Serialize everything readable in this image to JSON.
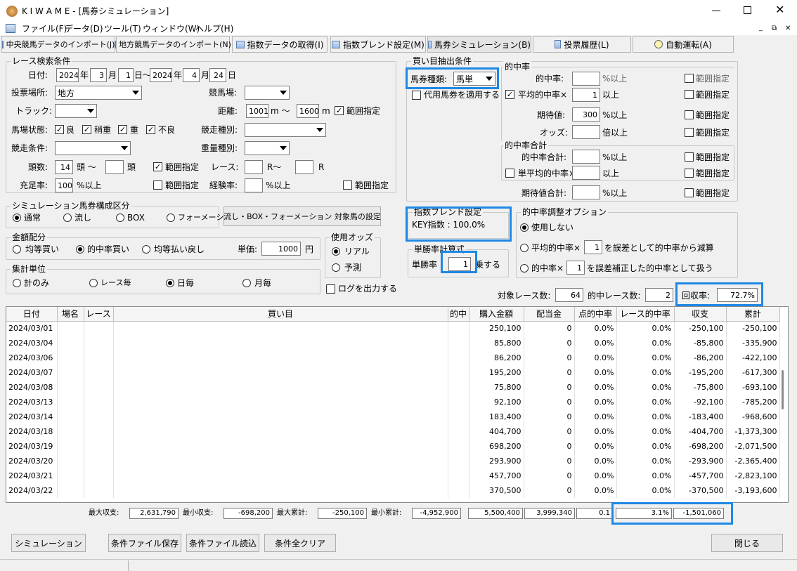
{
  "window": {
    "title": "K I W A M E - [馬券シミュレーション]"
  },
  "menu": [
    "ファイル(F)",
    "データ(D)",
    "ツール(T)",
    "ウィンドウ(W)",
    "ヘルプ(H)"
  ],
  "toolbar": [
    "中央競馬データのインポート(J)",
    "地方競馬データのインポート(N)",
    "指数データの取得(I)",
    "指数ブレンド設定(M)",
    "馬券シミュレーション(B)",
    "投票履歴(L)",
    "自動運転(A)"
  ],
  "search": {
    "title": "レース検索条件",
    "date_label": "日付:",
    "from_year": "2024",
    "from_month": "3",
    "from_day": "1",
    "to_year": "2024",
    "to_month": "4",
    "to_day": "24",
    "year": "年",
    "month": "月",
    "day": "日",
    "tilde": "日～",
    "venue_label": "投票場所:",
    "venue": "地方",
    "track_label": "競馬場:",
    "course_label": "トラック:",
    "distance_label": "距離:",
    "distance_from": "1001",
    "distance_to": "1600",
    "m_tilde": "m ～",
    "m": "m",
    "range": "範囲指定",
    "ground_label": "馬場状態:",
    "grounds": [
      "良",
      "稍重",
      "重",
      "不良"
    ],
    "race_type_label": "競走種別:",
    "race_cond_label": "競走条件:",
    "weight_label": "重量種別:",
    "heads_label": "頭数:",
    "heads_from": "14",
    "heads_unit": "頭 ～",
    "heads_unit2": "頭",
    "race_label": "レース:",
    "race_r1": "R～",
    "race_r2": "R",
    "fill_label": "充足率:",
    "fill_value": "100",
    "pct_above": "%以上",
    "exp_label": "経験率:"
  },
  "sim": {
    "title": "シミュレーション馬券構成区分",
    "options": [
      "通常",
      "流し",
      "BOX",
      "フォーメーション"
    ],
    "target_button": "流し・BOX・フォーメーション 対象馬の設定"
  },
  "money": {
    "title": "金額配分",
    "options": [
      "均等買い",
      "的中率買い",
      "均等払い戻し"
    ],
    "unit_label": "単価:",
    "unit_value": "1000",
    "yen": "円"
  },
  "odds": {
    "title": "使用オッズ",
    "options": [
      "リアル",
      "予測"
    ]
  },
  "agg": {
    "title": "集計単位",
    "options": [
      "計のみ",
      "レース毎",
      "日毎",
      "月毎"
    ]
  },
  "log_label": "ログを出力する",
  "buy": {
    "title": "買い目抽出条件",
    "ticket_label": "馬券種類:",
    "ticket_value": "馬単",
    "substitute": "代用馬券を適用する",
    "hit_title": "的中率",
    "hit_rate": "的中率:",
    "avg_hit": "平均的中率×",
    "avg_hit_value": "1",
    "above": "以上",
    "expect": "期待値:",
    "expect_value": "300",
    "odds_lbl": "オッズ:",
    "times_above": "倍以上",
    "sum_title": "的中率合計",
    "hit_sum": "的中率合計:",
    "single_avg": "単平均的中率×",
    "expect_sum": "期待値合計:",
    "range": "範囲指定",
    "pct_above": "%以上"
  },
  "blend": {
    "title": "指数ブレンド設定",
    "text": "KEY指数 : 100.0%"
  },
  "win_calc": {
    "title": "単勝率計算式",
    "prefix": "単勝率",
    "value": "1",
    "suffix": "乗する"
  },
  "adjust": {
    "title": "的中率調整オプション",
    "none": "使用しない",
    "opt1_a": "平均的中率×",
    "opt1_v": "1",
    "opt1_b": "を誤差として的中率から減算",
    "opt2_a": "的中率×",
    "opt2_v": "1",
    "opt2_b": "を誤差補正した的中率として扱う"
  },
  "stats": {
    "target_label": "対象レース数:",
    "target": "64",
    "hit_label": "的中レース数:",
    "hit": "2",
    "recovery_label": "回収率:",
    "recovery": "72.7%"
  },
  "table": {
    "headers": [
      "日付",
      "場名",
      "レース",
      "買い目",
      "的中",
      "購入金額",
      "配当金",
      "点的中率",
      "レース的中率",
      "収支",
      "累計"
    ],
    "rows": [
      [
        "2024/03/01",
        "",
        "",
        "",
        "",
        "250,100",
        "0",
        "0.0%",
        "0.0%",
        "-250,100",
        "-250,100"
      ],
      [
        "2024/03/04",
        "",
        "",
        "",
        "",
        "85,800",
        "0",
        "0.0%",
        "0.0%",
        "-85,800",
        "-335,900"
      ],
      [
        "2024/03/06",
        "",
        "",
        "",
        "",
        "86,200",
        "0",
        "0.0%",
        "0.0%",
        "-86,200",
        "-422,100"
      ],
      [
        "2024/03/07",
        "",
        "",
        "",
        "",
        "195,200",
        "0",
        "0.0%",
        "0.0%",
        "-195,200",
        "-617,300"
      ],
      [
        "2024/03/08",
        "",
        "",
        "",
        "",
        "75,800",
        "0",
        "0.0%",
        "0.0%",
        "-75,800",
        "-693,100"
      ],
      [
        "2024/03/13",
        "",
        "",
        "",
        "",
        "92,100",
        "0",
        "0.0%",
        "0.0%",
        "-92,100",
        "-785,200"
      ],
      [
        "2024/03/14",
        "",
        "",
        "",
        "",
        "183,400",
        "0",
        "0.0%",
        "0.0%",
        "-183,400",
        "-968,600"
      ],
      [
        "2024/03/18",
        "",
        "",
        "",
        "",
        "404,700",
        "0",
        "0.0%",
        "0.0%",
        "-404,700",
        "-1,373,300"
      ],
      [
        "2024/03/19",
        "",
        "",
        "",
        "",
        "698,200",
        "0",
        "0.0%",
        "0.0%",
        "-698,200",
        "-2,071,500"
      ],
      [
        "2024/03/20",
        "",
        "",
        "",
        "",
        "293,900",
        "0",
        "0.0%",
        "0.0%",
        "-293,900",
        "-2,365,400"
      ],
      [
        "2024/03/21",
        "",
        "",
        "",
        "",
        "457,700",
        "0",
        "0.0%",
        "0.0%",
        "-457,700",
        "-2,823,100"
      ],
      [
        "2024/03/22",
        "",
        "",
        "",
        "",
        "370,500",
        "0",
        "0.0%",
        "0.0%",
        "-370,500",
        "-3,193,600"
      ]
    ]
  },
  "summary": {
    "max_income_label": "最大収支:",
    "max_income": "2,631,790",
    "min_income_label": "最小収支:",
    "min_income": "-698,200",
    "max_total_label": "最大累計:",
    "max_total": "-250,100",
    "min_total_label": "最小累計:",
    "min_total": "-4,952,900",
    "total_purchase": "5,500,400",
    "total_payout": "3,999,340",
    "point_hit": "0.1",
    "race_hit": "3.1%",
    "total_income": "-1,501,060"
  },
  "buttons": {
    "simulate": "シミュレーション",
    "save": "条件ファイル保存",
    "load": "条件ファイル読込",
    "clear": "条件全クリア",
    "close": "閉じる"
  }
}
